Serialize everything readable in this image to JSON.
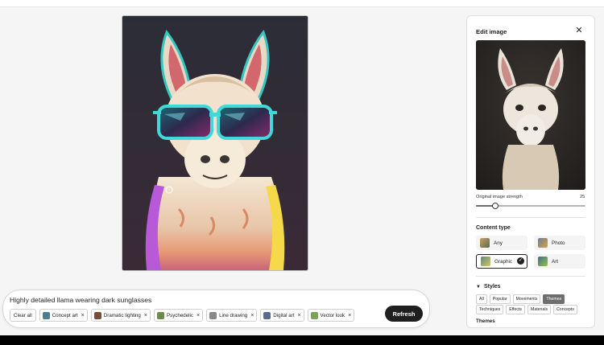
{
  "prompt": {
    "text": "Highly detailed llama wearing dark sunglasses",
    "clear_label": "Clear all",
    "chips": [
      {
        "label": "Concept art",
        "color": "#4d7d8e"
      },
      {
        "label": "Dramatic lighting",
        "color": "#7a4a3a"
      },
      {
        "label": "Psychedelic",
        "color": "#6c8a4a"
      },
      {
        "label": "Line drawing",
        "color": "#888888"
      },
      {
        "label": "Digital art",
        "color": "#5a6b8e"
      },
      {
        "label": "Vector look",
        "color": "#7aa35a"
      }
    ],
    "refresh_label": "Refresh"
  },
  "panel": {
    "title": "Edit image",
    "strength_label": "Original image strength",
    "strength_value": "25",
    "content_type_title": "Content type",
    "content_types": [
      {
        "label": "Any",
        "selected": false
      },
      {
        "label": "Photo",
        "selected": false
      },
      {
        "label": "Graphic",
        "selected": true
      },
      {
        "label": "Art",
        "selected": false
      }
    ],
    "styles_title": "Styles",
    "style_tabs_row1": [
      "All",
      "Popular",
      "Movements",
      "Themes"
    ],
    "style_tabs_row2": [
      "Techniques",
      "Effects",
      "Materials",
      "Concepts"
    ],
    "active_tab": "Themes",
    "themes_label": "Themes"
  },
  "colors": {
    "accent_dark": "#1f1f1f",
    "panel_bg": "#ffffff",
    "page_bg": "#f5f5f5"
  }
}
